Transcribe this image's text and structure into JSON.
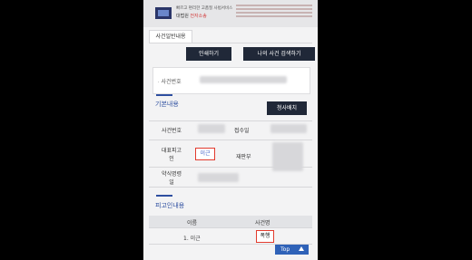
{
  "banner": {
    "line1": "빠르고 편리한 고품질 사법서비스",
    "line2_prefix": "대법원 ",
    "line2_highlight": "전자소송"
  },
  "tabs": {
    "case_general": "사건일반내용"
  },
  "buttons": {
    "print": "인쇄하기",
    "my_case_search": "나의 사건 검색하기",
    "petition": "청사배치"
  },
  "search": {
    "case_number_label": "사건번호"
  },
  "sections": {
    "basic": "기본내용",
    "defendants": "피고인내용"
  },
  "basic_info": {
    "case_number_label": "사건번호",
    "receipt_date_label": "접수일",
    "representative_defendant_label": "대표피고\n인",
    "representative_defendant_value": "이근",
    "court_label": "재판부",
    "summary_order_label": "약식명령\n일"
  },
  "defendant_table": {
    "col_name": "이름",
    "col_case_name": "사건명",
    "rows": [
      {
        "name": "1. 이근",
        "case_name": "폭행"
      }
    ]
  },
  "top_button": {
    "label": "Top"
  }
}
